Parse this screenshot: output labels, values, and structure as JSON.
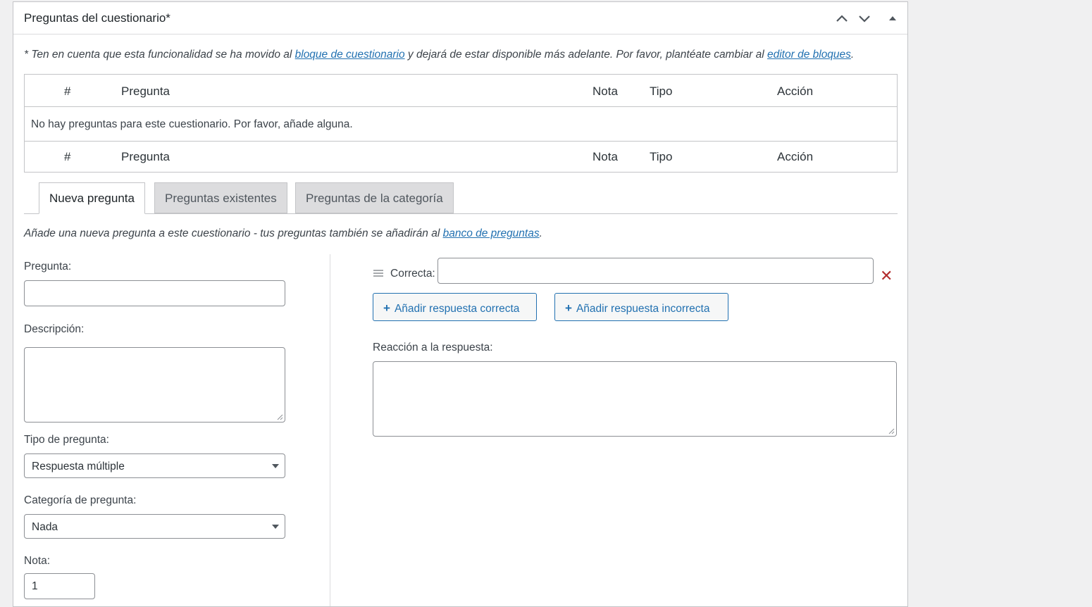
{
  "metabox": {
    "title": "Preguntas del cuestionario*",
    "controls": {
      "up_icon": "chevron-up-icon",
      "down_icon": "chevron-down-icon",
      "toggle_icon": "triangle-up-icon"
    }
  },
  "notice": {
    "prefix": "* Ten en cuenta que esta funcionalidad se ha movido al ",
    "link1": "bloque de cuestionario",
    "middle": " y dejará de estar disponible más adelante. Por favor, plantéate cambiar al ",
    "link2": "editor de bloques",
    "suffix": "."
  },
  "table": {
    "columns": [
      "#",
      "Pregunta",
      "Nota",
      "Tipo",
      "Acción"
    ],
    "empty_message": "No hay preguntas para este cuestionario. Por favor, añade alguna."
  },
  "tabs": [
    {
      "label": "Nueva pregunta",
      "active": true
    },
    {
      "label": "Preguntas existentes",
      "active": false
    },
    {
      "label": "Preguntas de la categoría",
      "active": false
    }
  ],
  "tab_description": {
    "prefix": "Añade una nueva pregunta a este cuestionario - tus preguntas también se añadirán al ",
    "link": "banco de preguntas",
    "suffix": "."
  },
  "form": {
    "question_label": "Pregunta:",
    "question_value": "",
    "description_label": "Descripción:",
    "description_value": "",
    "type_label": "Tipo de pregunta:",
    "type_value": "Respuesta múltiple",
    "category_label": "Categoría de pregunta:",
    "category_value": "Nada",
    "grade_label": "Nota:",
    "grade_value": "1"
  },
  "answers": {
    "correct_label": "Correcta:",
    "correct_value": "",
    "add_correct_label": "Añadir respuesta correcta",
    "add_incorrect_label": "Añadir respuesta incorrecta",
    "feedback_label": "Reacción a la respuesta:",
    "feedback_value": "",
    "remove_icon": "close-icon",
    "remove_color": "#b32d2e"
  },
  "colors": {
    "accent": "#2271b1",
    "danger": "#b32d2e"
  }
}
